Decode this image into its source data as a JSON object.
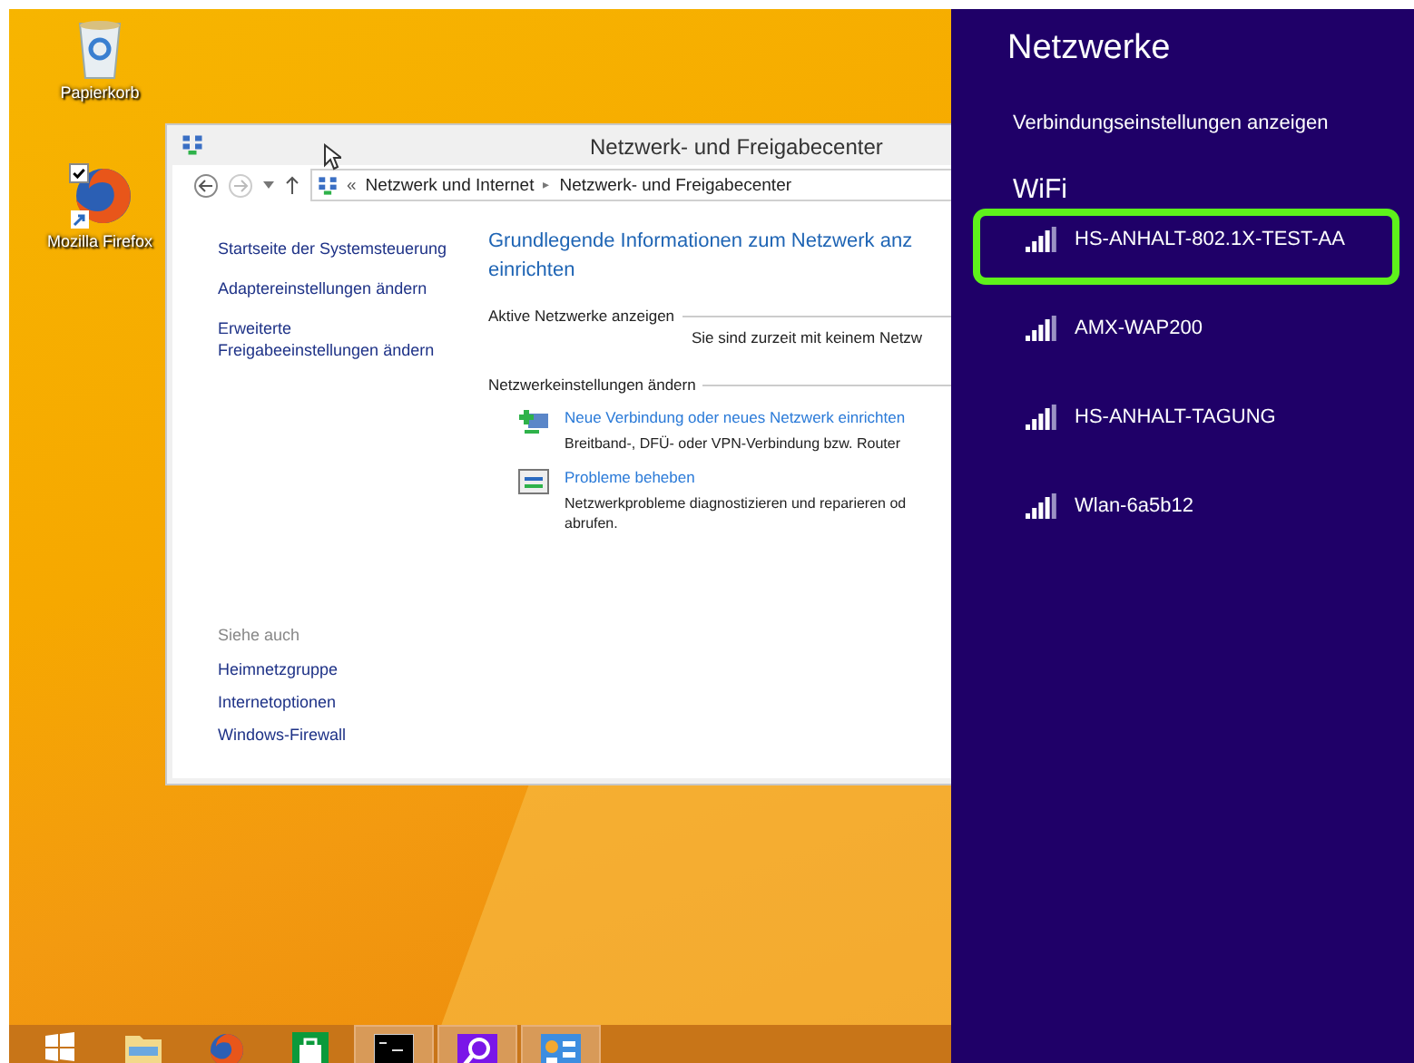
{
  "desktop_icons": [
    {
      "kind": "recycle-bin",
      "label": "Papierkorb",
      "checked": false
    },
    {
      "kind": "firefox",
      "label": "Mozilla Firefox",
      "checked": true
    }
  ],
  "window": {
    "title": "Netzwerk- und Freigabecenter",
    "address_prefix": "«",
    "breadcrumb_separator": "▸",
    "breadcrumb": [
      "Netzwerk und Internet",
      "Netzwerk- und Freigabecenter"
    ],
    "sidebar_links": [
      "Startseite der Systemsteuerung",
      "Adaptereinstellungen ändern",
      "Erweiterte Freigabeeinstellungen ändern"
    ],
    "see_also": {
      "heading": "Siehe auch",
      "links": [
        "Heimnetzgruppe",
        "Internetoptionen",
        "Windows-Firewall"
      ]
    },
    "heading_lines": [
      "Grundlegende Informationen zum Netzwerk anz",
      "einrichten"
    ],
    "active_networks": {
      "heading": "Aktive Netzwerke anzeigen",
      "message": "Sie sind zurzeit mit keinem Netzw"
    },
    "settings": {
      "heading": "Netzwerkeinstellungen ändern",
      "tasks": [
        {
          "kind": "new-connection",
          "link": "Neue Verbindung oder neues Netzwerk einrichten",
          "lines": [
            "Breitband-, DFÜ- oder VPN-Verbindung bzw. Router"
          ]
        },
        {
          "kind": "troubleshoot",
          "link": "Probleme beheben",
          "lines": [
            "Netzwerkprobleme diagnostizieren und reparieren od",
            "abrufen."
          ]
        }
      ]
    }
  },
  "taskbar": [
    {
      "kind": "start",
      "active": false
    },
    {
      "kind": "explorer",
      "active": false
    },
    {
      "kind": "firefox",
      "active": false
    },
    {
      "kind": "store",
      "active": false
    },
    {
      "kind": "cmd",
      "active": true
    },
    {
      "kind": "search",
      "active": true
    },
    {
      "kind": "control-panel",
      "active": true
    }
  ],
  "networks_panel": {
    "title": "Netzwerke",
    "settings_link": "Verbindungseinstellungen anzeigen",
    "section": "WiFi",
    "networks": [
      {
        "name": "HS-ANHALT-802.1X-TEST-AA",
        "selected": true
      },
      {
        "name": "AMX-WAP200",
        "selected": false
      },
      {
        "name": "HS-ANHALT-TAGUNG",
        "selected": false
      },
      {
        "name": "Wlan-6a5b12",
        "selected": false
      }
    ]
  }
}
